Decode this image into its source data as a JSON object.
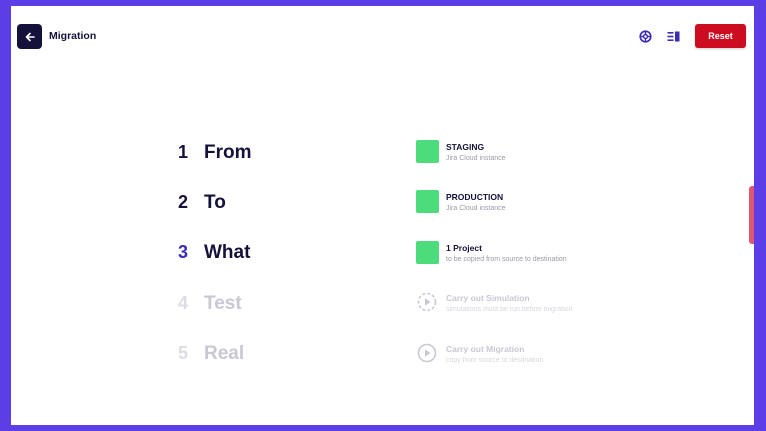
{
  "header": {
    "title": "Migration",
    "back_icon": "arrow-left-icon",
    "help_icon": "lifebuoy-icon",
    "panel_icon": "panel-toggle-icon",
    "reset_label": "Reset"
  },
  "colors": {
    "frame": "#5b3ee6",
    "accent": "#3b2bb8",
    "dark": "#14123a",
    "done": "#4cdc7c",
    "reset": "#cc0c1f"
  },
  "steps": [
    {
      "number": "1",
      "name": "From",
      "state": "done",
      "title": "STAGING",
      "subtitle": "Jira Cloud instance"
    },
    {
      "number": "2",
      "name": "To",
      "state": "done",
      "title": "PRODUCTION",
      "subtitle": "Jira Cloud instance"
    },
    {
      "number": "3",
      "name": "What",
      "state": "current",
      "title": "1 Project",
      "subtitle": "to be copied from source to destination"
    },
    {
      "number": "4",
      "name": "Test",
      "state": "pending",
      "title": "Carry out Simulation",
      "subtitle": "simulations must be run before migration"
    },
    {
      "number": "5",
      "name": "Real",
      "state": "pending",
      "title": "Carry out Migration",
      "subtitle": "copy from source to destination"
    }
  ]
}
